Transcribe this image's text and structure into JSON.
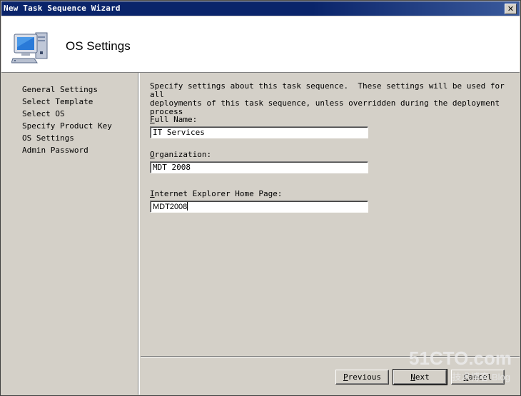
{
  "window": {
    "title": "New Task Sequence Wizard",
    "close_label": "✕"
  },
  "header": {
    "title": "OS Settings",
    "icon": "computer-icon"
  },
  "sidebar": {
    "items": [
      {
        "label": "General Settings"
      },
      {
        "label": "Select Template"
      },
      {
        "label": "Select OS"
      },
      {
        "label": "Specify Product Key"
      },
      {
        "label": "OS Settings"
      },
      {
        "label": "Admin Password"
      }
    ]
  },
  "main": {
    "description": "Specify settings about this task sequence.  These settings will be used for all\ndeployments of this task sequence, unless overridden during the deployment process",
    "fields": [
      {
        "label_accel": "F",
        "label_rest": "ull Name:",
        "value": "IT Services"
      },
      {
        "label_accel": "O",
        "label_rest": "rganization:",
        "value": "MDT 2008"
      },
      {
        "label_accel": "I",
        "label_rest": "nternet Explorer Home Page:",
        "value": "MDT2008"
      }
    ]
  },
  "buttons": {
    "previous": {
      "accel": "P",
      "rest": "revious"
    },
    "next": {
      "accel": "N",
      "rest": "ext"
    },
    "cancel": {
      "accel": "C",
      "rest": "ancel"
    }
  },
  "watermark": {
    "line1": "51CTO.com",
    "line2": "技术博客 Blog"
  },
  "colors": {
    "titlebar": "#0a246a",
    "face": "#d4d0c8",
    "header_bg": "#ffffff"
  }
}
